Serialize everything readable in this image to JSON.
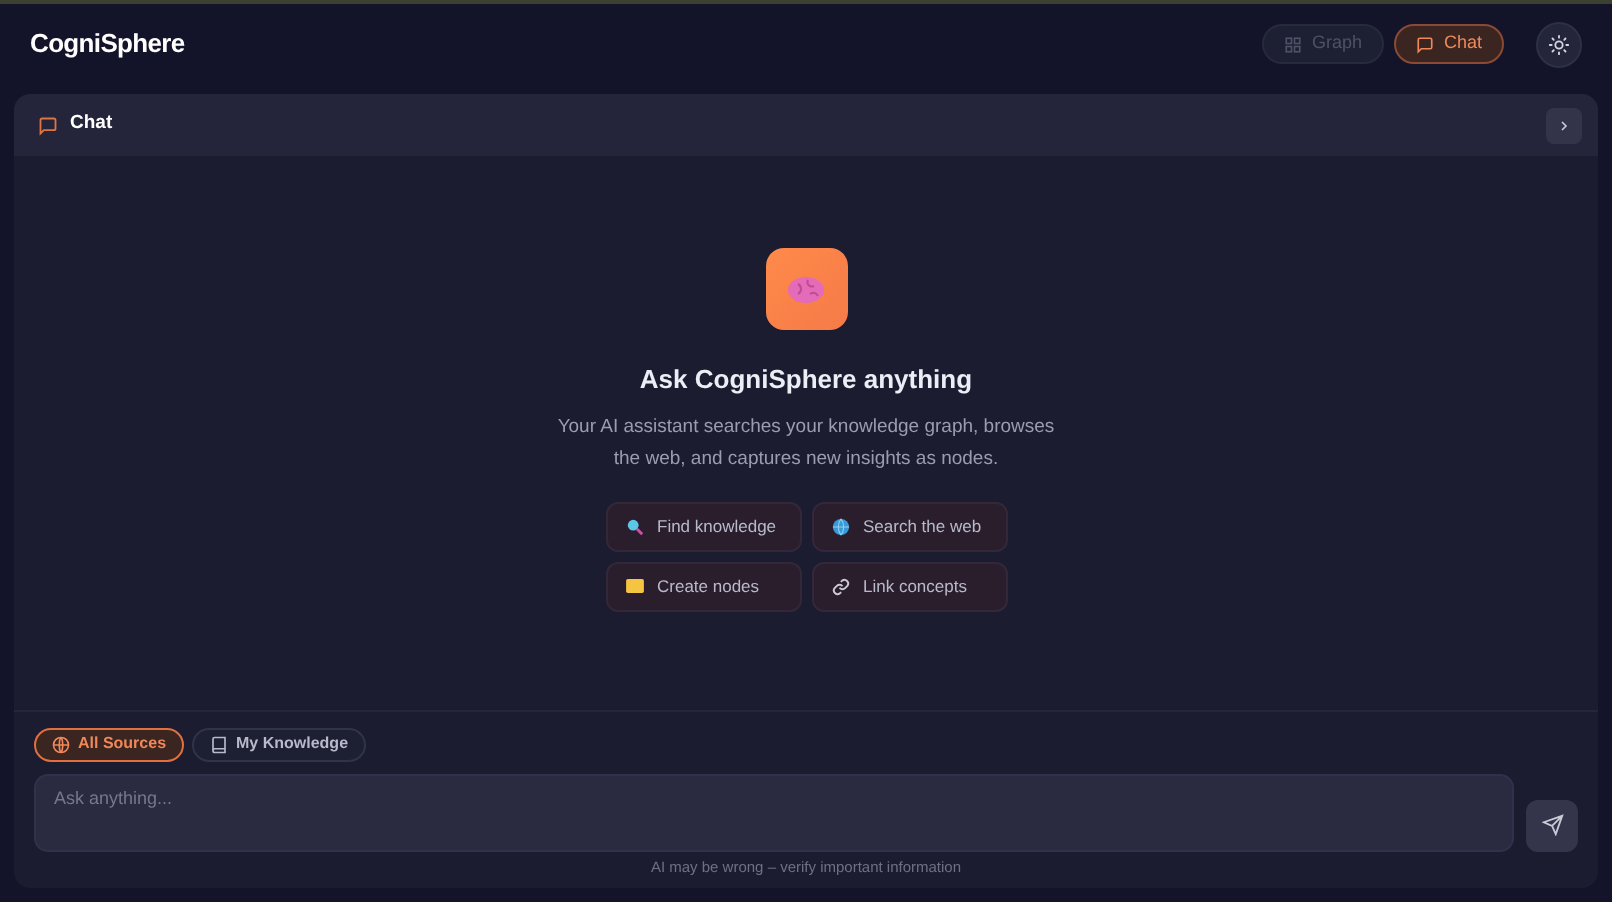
{
  "app": {
    "title": "CogniSphere"
  },
  "views": [
    {
      "label": "Graph",
      "selected": false
    },
    {
      "label": "Chat",
      "selected": true
    }
  ],
  "panel": {
    "title": "Chat"
  },
  "empty_state": {
    "heading": "Ask CogniSphere anything",
    "description": "Your AI assistant searches your knowledge graph, browses the web, and captures new insights as nodes."
  },
  "suggestions": [
    {
      "label": "Find knowledge"
    },
    {
      "label": "Search the web"
    },
    {
      "label": "Create nodes"
    },
    {
      "label": "Link concepts"
    }
  ],
  "sources": [
    {
      "label": "All Sources",
      "selected": true
    },
    {
      "label": "My Knowledge",
      "selected": false
    }
  ],
  "composer": {
    "placeholder": "Ask anything..."
  },
  "disclaimer": "AI may be wrong – verify important information"
}
